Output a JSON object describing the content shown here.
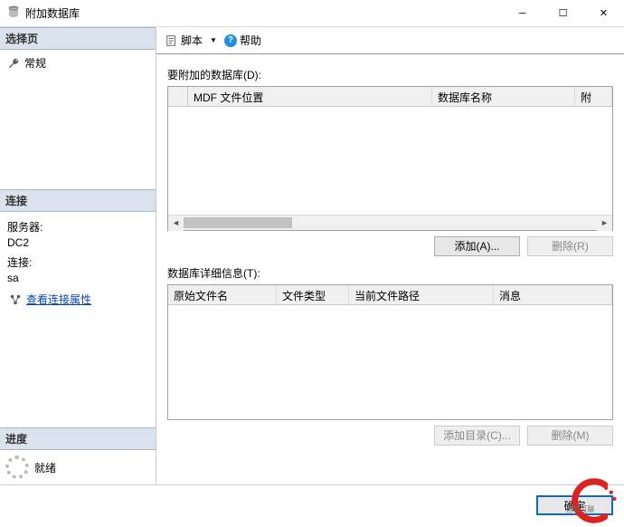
{
  "window": {
    "title": "附加数据库"
  },
  "sidebar": {
    "select_page_header": "选择页",
    "general_item": "常规",
    "connection_header": "连接",
    "server_label": "服务器:",
    "server_value": "DC2",
    "conn_label": "连接:",
    "conn_value": "sa",
    "view_props_link": "查看连接属性",
    "progress_header": "进度",
    "ready_text": "就绪"
  },
  "toolbar": {
    "script_label": "脚本",
    "help_label": "帮助"
  },
  "main": {
    "attach_label": "要附加的数据库(D):",
    "grid1": {
      "col_mdf": "MDF 文件位置",
      "col_dbname": "数据库名称",
      "col_attach": "附"
    },
    "btn_add": "添加(A)...",
    "btn_remove": "删除(R)",
    "detail_label": "数据库详细信息(T):",
    "grid2": {
      "col_orig": "原始文件名",
      "col_type": "文件类型",
      "col_path": "当前文件路径",
      "col_msg": "消息"
    },
    "btn_add_dir": "添加目录(C)...",
    "btn_remove2": "删除(M)"
  },
  "footer": {
    "ok": "确定",
    "cancel": ""
  },
  "watermark": {
    "text": "创新互联"
  }
}
